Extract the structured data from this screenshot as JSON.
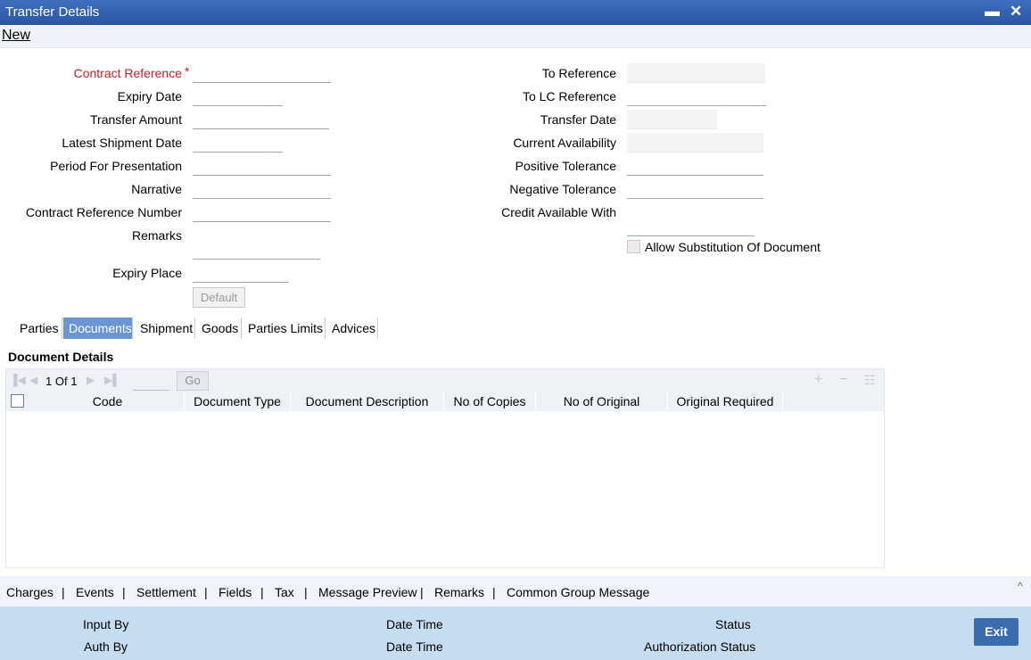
{
  "window": {
    "title": "Transfer Details",
    "minimize_label": "▬",
    "close_label": "✕"
  },
  "menu": {
    "new_label": "New"
  },
  "form": {
    "left": [
      {
        "label": "Contract Reference",
        "required": true,
        "value": ""
      },
      {
        "label": "Expiry Date",
        "value": ""
      },
      {
        "label": "Transfer Amount",
        "value": ""
      },
      {
        "label": "Latest Shipment Date",
        "value": ""
      },
      {
        "label": "Period For Presentation",
        "value": ""
      },
      {
        "label": "Narrative",
        "value": ""
      },
      {
        "label": "Contract Reference Number",
        "value": ""
      },
      {
        "label": "Remarks",
        "value": ""
      },
      {
        "label": "Expiry Place",
        "value": ""
      }
    ],
    "right": [
      {
        "label": "To Reference",
        "value": ""
      },
      {
        "label": "To LC Reference",
        "value": ""
      },
      {
        "label": "Transfer Date",
        "value": ""
      },
      {
        "label": "Current Availability",
        "value": ""
      },
      {
        "label": "Positive Tolerance",
        "value": ""
      },
      {
        "label": "Negative Tolerance",
        "value": ""
      },
      {
        "label": "Credit Available With",
        "value": ""
      }
    ],
    "required_marker": "*",
    "allow_substitution_label": "Allow Substitution Of Document",
    "allow_substitution_checked": false,
    "default_button": "Default"
  },
  "tabs": [
    {
      "label": "Parties",
      "active": false
    },
    {
      "label": "Documents",
      "active": true
    },
    {
      "label": "Shipment",
      "active": false
    },
    {
      "label": "Goods",
      "active": false
    },
    {
      "label": "Parties Limits",
      "active": false
    },
    {
      "label": "Advices",
      "active": false
    }
  ],
  "documents": {
    "section_title": "Document Details",
    "pager": {
      "current": "1",
      "of_label": "Of",
      "total": "1",
      "go_label": "Go"
    },
    "toolbar_icons": [
      "first-page-icon",
      "previous-page-icon",
      "next-page-icon",
      "last-page-icon",
      "add-row-icon",
      "delete-row-icon",
      "view-row-icon"
    ],
    "columns": [
      "Code",
      "Document Type",
      "Document Description",
      "No of Copies",
      "No of Original",
      "Original Required"
    ],
    "rows": []
  },
  "bottom_links": [
    "Charges",
    "Events",
    "Settlement",
    "Fields",
    "Tax",
    "Message Preview",
    "Remarks",
    "Common Group Message"
  ],
  "footer": {
    "input_by": "Input By",
    "auth_by": "Auth By",
    "date_time_1": "Date Time",
    "date_time_2": "Date Time",
    "status": "Status",
    "authorization_status": "Authorization Status",
    "exit_label": "Exit"
  },
  "colors": {
    "titlebar": "#2f5fae",
    "active_tab": "#6b96d4",
    "required_label": "#c0202a",
    "footer_bg": "#c6ddf0",
    "exit_button": "#3a6db0"
  }
}
